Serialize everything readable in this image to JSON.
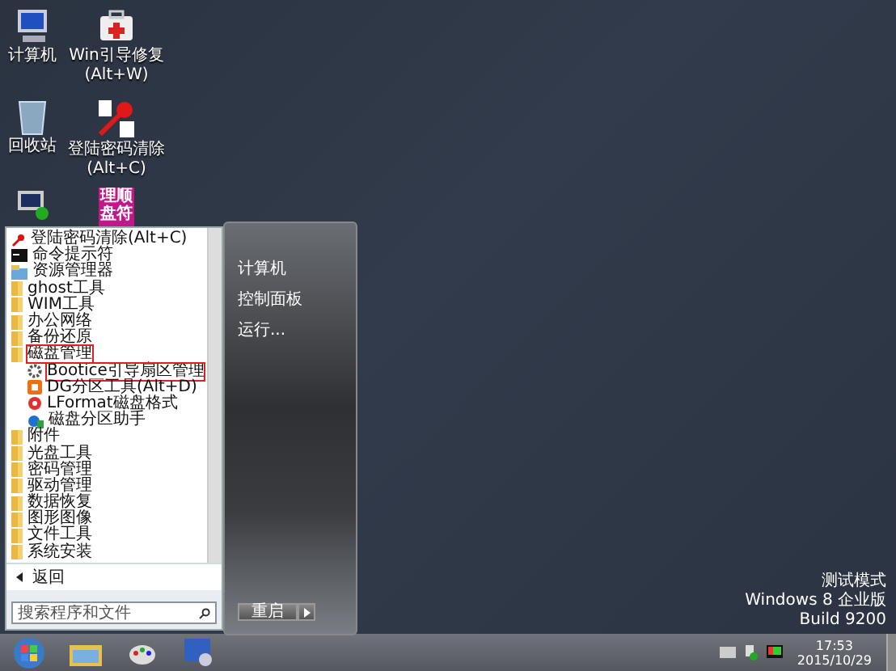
{
  "desktop_icons": [
    {
      "kind": "computer",
      "lines": [
        "计算机"
      ]
    },
    {
      "kind": "medkit",
      "lines": [
        "Win引导修复",
        "(Alt+W)"
      ]
    },
    {
      "kind": "recycle",
      "lines": [
        "回收站"
      ]
    },
    {
      "kind": "key",
      "lines": [
        "登陆密码清除",
        "(Alt+C)"
      ]
    },
    {
      "kind": "network"
    },
    {
      "kind": "tile",
      "tile_text": "理顺盘符"
    }
  ],
  "start_menu": {
    "programs": [
      {
        "kind": "key",
        "label": "登陆密码清除(Alt+C)",
        "highlighted": false
      },
      {
        "kind": "cmd",
        "label": "命令提示符",
        "highlighted": false
      },
      {
        "kind": "explorer",
        "label": "资源管理器",
        "highlighted": false
      },
      {
        "kind": "folder",
        "label": "ghost工具",
        "highlighted": false
      },
      {
        "kind": "folder",
        "label": "WIM工具",
        "highlighted": false
      },
      {
        "kind": "folder",
        "label": "办公网络",
        "highlighted": false
      },
      {
        "kind": "folder",
        "label": "备份还原",
        "highlighted": false
      },
      {
        "kind": "folder",
        "label": "磁盘管理",
        "highlighted": true,
        "expanded": true,
        "children": [
          {
            "kind": "gear",
            "label": "Bootice引导扇区管理",
            "highlighted": true
          },
          {
            "kind": "dg",
            "label": "DG分区工具(Alt+D)",
            "highlighted": false
          },
          {
            "kind": "lformat",
            "label": "LFormat磁盘格式",
            "highlighted": false
          },
          {
            "kind": "partition",
            "label": "磁盘分区助手",
            "highlighted": false
          }
        ]
      },
      {
        "kind": "folder",
        "label": "附件",
        "highlighted": false
      },
      {
        "kind": "folder",
        "label": "光盘工具",
        "highlighted": false
      },
      {
        "kind": "folder",
        "label": "密码管理",
        "highlighted": false
      },
      {
        "kind": "folder",
        "label": "驱动管理",
        "highlighted": false
      },
      {
        "kind": "folder",
        "label": "数据恢复",
        "highlighted": false
      },
      {
        "kind": "folder",
        "label": "图形图像",
        "highlighted": false
      },
      {
        "kind": "folder",
        "label": "文件工具",
        "highlighted": false
      },
      {
        "kind": "folder",
        "label": "系统安装",
        "highlighted": false
      }
    ],
    "back": "返回",
    "search": {
      "placeholder": "搜索程序和文件"
    },
    "right_items": [
      "计算机",
      "控制面板",
      "运行..."
    ],
    "power_button": "重启"
  },
  "watermark_info": [
    "测试模式",
    "Windows 8 企业版",
    "Build 9200"
  ],
  "taskbar": {
    "pinned": [
      {
        "kind": "folder"
      },
      {
        "kind": "paint"
      },
      {
        "kind": "tool"
      }
    ],
    "clock": {
      "time": "17:53",
      "date": "2015/10/29"
    }
  }
}
